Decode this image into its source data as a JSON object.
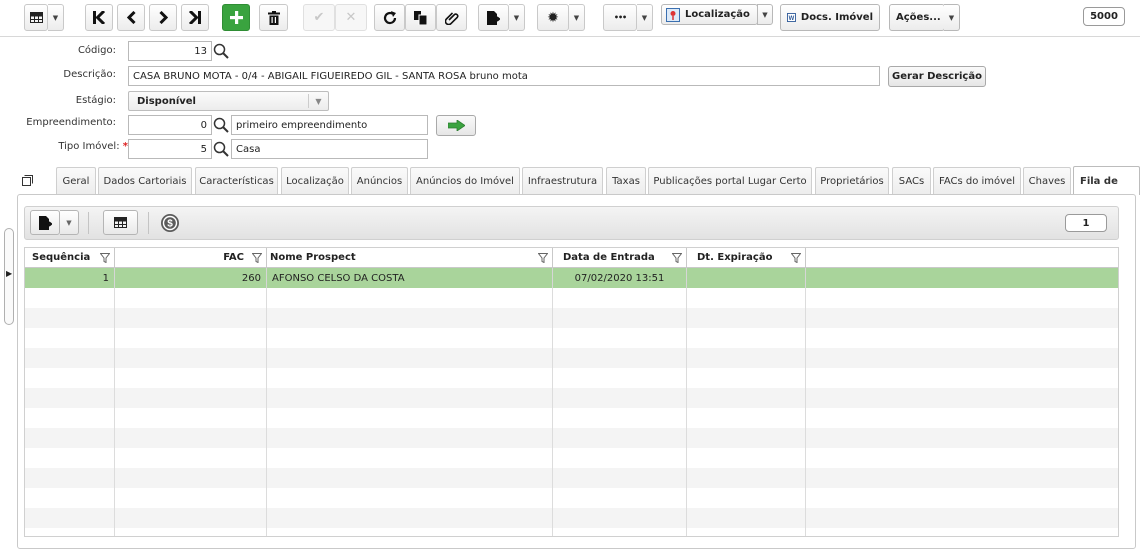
{
  "toolbar": {
    "counter": "5000",
    "localizacao_label": "Localização",
    "docs_label": "Docs. Imóvel",
    "acoes_label": "Ações...",
    "ellipsis_label": "•••"
  },
  "form": {
    "codigo": {
      "label": "Código:",
      "value": "13"
    },
    "descricao": {
      "label": "Descrição:",
      "value": "CASA BRUNO MOTA - 0/4 - ABIGAIL FIGUEIREDO GIL - SANTA ROSA bruno mota",
      "button": "Gerar Descrição"
    },
    "estagio": {
      "label": "Estágio:",
      "value": "Disponível"
    },
    "empreendimento": {
      "label": "Empreendimento:",
      "code": "0",
      "name": "primeiro empreendimento"
    },
    "tipo_imovel": {
      "label": "Tipo Imóvel:",
      "required_mark": "*",
      "code": "5",
      "name": "Casa"
    }
  },
  "tabs": [
    {
      "label": "Geral"
    },
    {
      "label": "Dados Cartoriais"
    },
    {
      "label": "Características"
    },
    {
      "label": "Localização"
    },
    {
      "label": "Anúncios"
    },
    {
      "label": "Anúncios do Imóvel"
    },
    {
      "label": "Infraestrutura"
    },
    {
      "label": "Taxas"
    },
    {
      "label": "Publicações portal Lugar Certo"
    },
    {
      "label": "Proprietários"
    },
    {
      "label": "SACs"
    },
    {
      "label": "FACs do imóvel"
    },
    {
      "label": "Chaves"
    },
    {
      "label": "Fila de"
    }
  ],
  "active_tab": "Fila de",
  "subpanel": {
    "counter": "1"
  },
  "grid": {
    "columns": [
      "Sequência",
      "FAC",
      "Nome Prospect",
      "Data de Entrada",
      "Dt. Expiração"
    ],
    "rows": [
      {
        "sequencia": "1",
        "fac": "260",
        "nome": "AFONSO CELSO DA COSTA",
        "data_entrada": "07/02/2020 13:51",
        "dt_expiracao": ""
      }
    ],
    "selected_row_color": "#a9d49b",
    "stripe_color": "#f4f4f4"
  },
  "colors": {
    "green_button": "#3aa33f",
    "accent_arrow": "#3aa33f"
  }
}
